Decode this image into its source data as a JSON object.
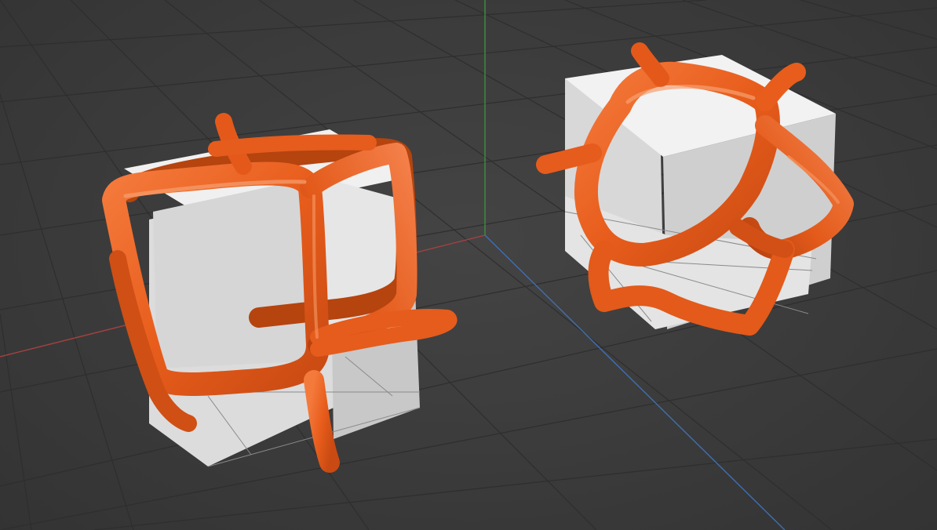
{
  "viewport": {
    "background_color": "#3d3d3d",
    "grid_color": "#2d2d2d",
    "x_axis_color": "#b04040",
    "y_axis_color": "#3f8f3f",
    "z_axis_color": "#3f6fb0"
  },
  "scene": {
    "objects": [
      {
        "name": "cube-left",
        "cube_color": "#e2e2e2",
        "cage_color": "#e85d1c",
        "cage_style": "square-cage"
      },
      {
        "name": "cube-right",
        "cube_color": "#e2e2e2",
        "cage_color": "#e85d1c",
        "cage_style": "voronoi-cage"
      }
    ]
  }
}
